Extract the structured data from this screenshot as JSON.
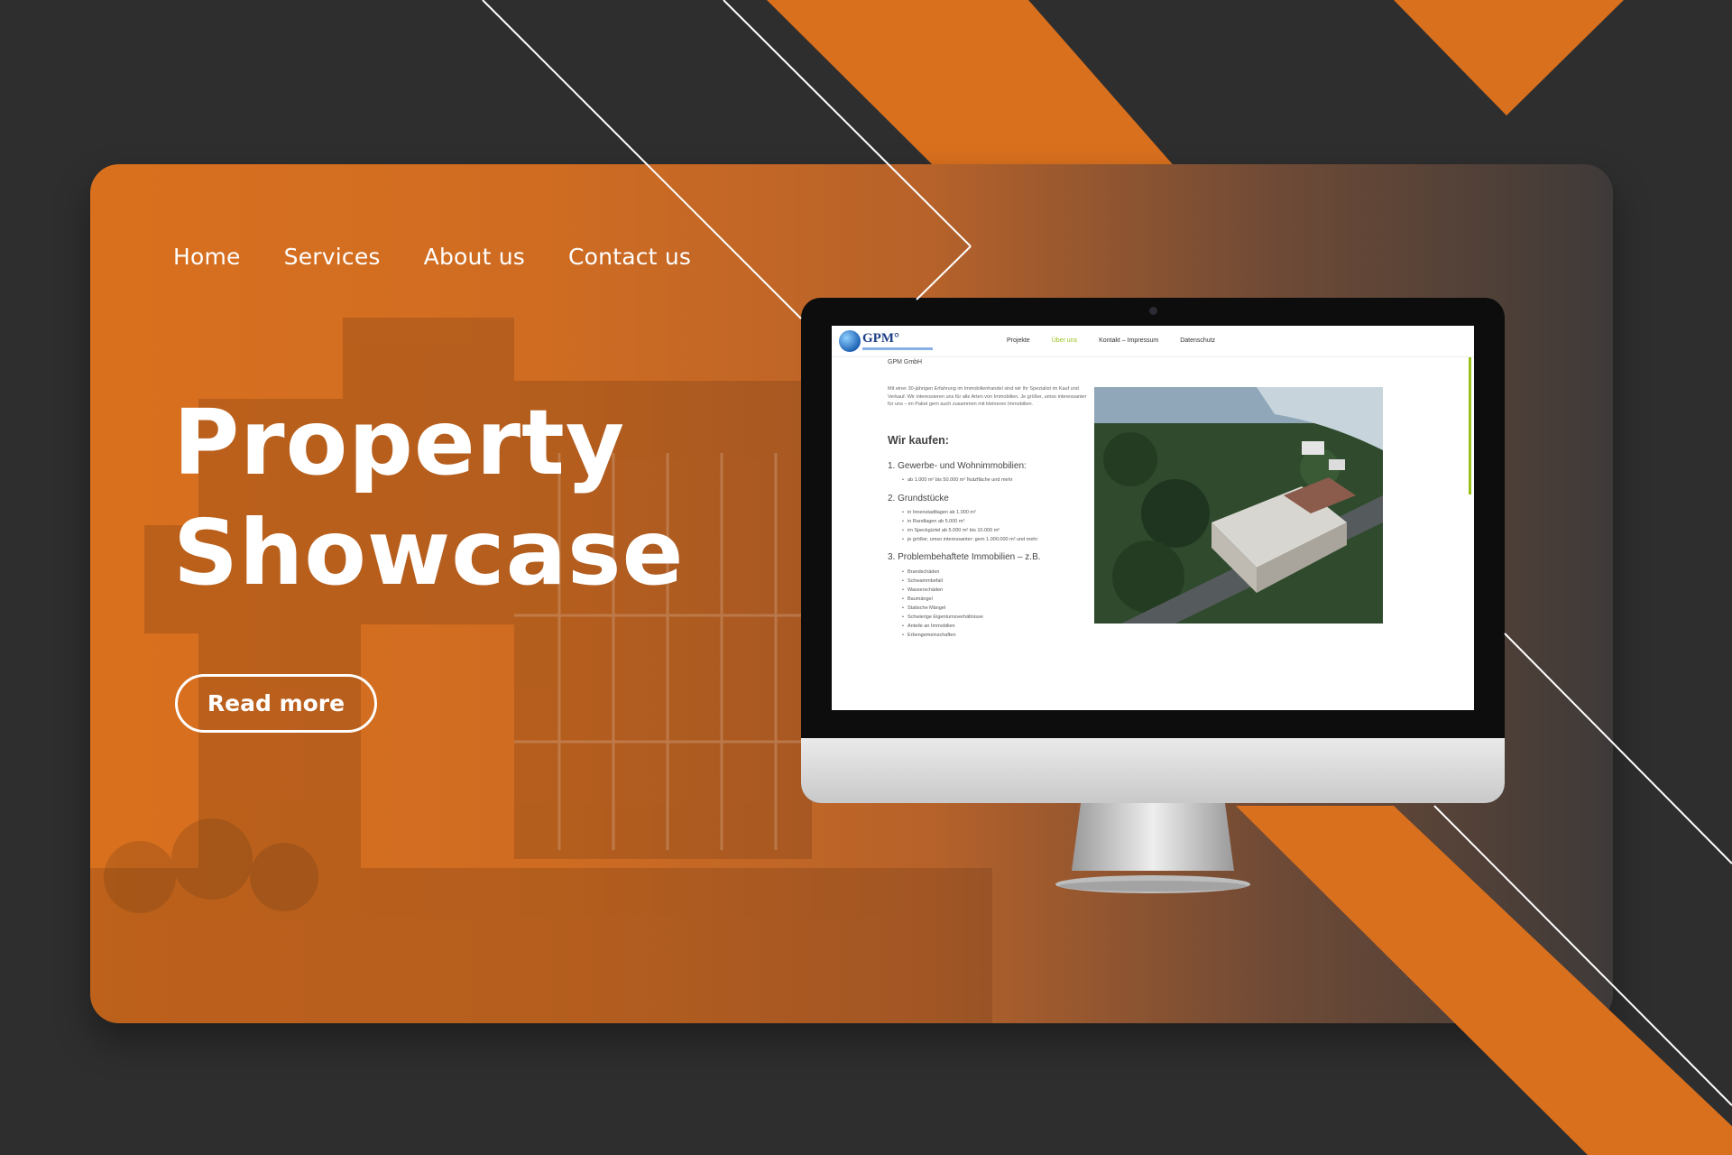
{
  "nav": {
    "items": [
      "Home",
      "Services",
      "About us",
      "Contact us"
    ]
  },
  "hero": {
    "title_line1": "Property",
    "title_line2": "Showcase",
    "button_label": "Read more"
  },
  "screen": {
    "logo_text": "GPM°",
    "nav_items": [
      "Projekte",
      "Über uns",
      "Kontakt – Impressum",
      "Datenschutz"
    ],
    "active_nav": "Über uns",
    "breadcrumb": "GPM GmbH",
    "intro": "Mit einer 30-jährigen Erfahrung im Immobilienhandel sind wir Ihr Spezialist im Kauf und Verkauf. Wir interessieren uns für alle Arten von Immobilien. Je größer, umso interessanter für uns – im Paket gern auch zusammen mit kleineren Immobilien.",
    "heading": "Wir kaufen:",
    "sections": [
      {
        "title": "1. Gewerbe- und Wohnimmobilien:",
        "items": [
          "ab 1.000 m² bis 50.000 m² Nutzfläche und mehr"
        ]
      },
      {
        "title": "2. Grundstücke",
        "items": [
          "in Innenstadtlagen ab 1.000 m²",
          "in Randlagen ab 5.000 m²",
          "im Speckgürtel ab 5.000 m² bis 10.000 m²",
          "je größer, umso interessanter: gern 1.000.000 m² und mehr"
        ]
      },
      {
        "title": "3. Problembehaftete Immobilien – z.B.",
        "items": [
          "Brandschäden",
          "Schwammbefall",
          "Wasserschäden",
          "Baumängel",
          "Statische Mängel",
          "Schwierige Eigentumsverhältnisse",
          "Anteile an Immobilien",
          "Erbengemeinschaften"
        ]
      }
    ]
  },
  "colors": {
    "accent": "#d9701e",
    "background": "#2e2e2e",
    "screen_accent": "#9ac11b"
  }
}
